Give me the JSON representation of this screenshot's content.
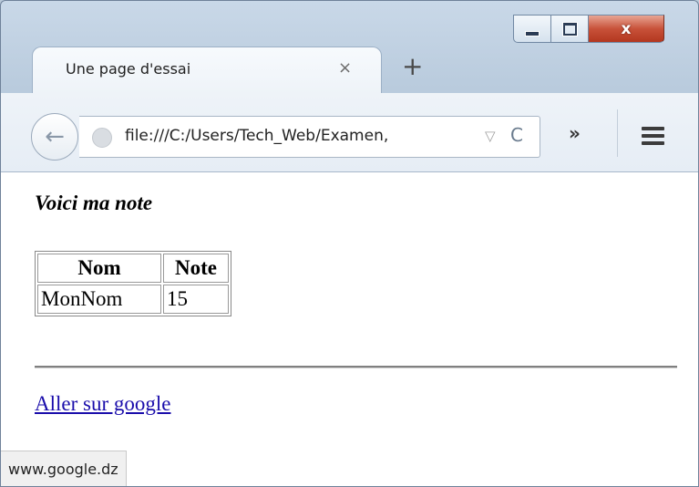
{
  "window": {
    "close_glyph": "x"
  },
  "tab": {
    "title": "Une page d'essai",
    "close_glyph": "×"
  },
  "new_tab_glyph": "+",
  "toolbar": {
    "back_glyph": "←",
    "url": "file:///C:/Users/Tech_Web/Examen,",
    "dropdown_glyph": "▽",
    "reload_glyph": "C",
    "overflow_glyph": "»"
  },
  "page": {
    "heading": "Voici ma note",
    "table": {
      "headers": [
        "Nom",
        "Note"
      ],
      "rows": [
        [
          "MonNom",
          "15"
        ]
      ]
    },
    "link_text": "Aller sur google"
  },
  "status_bar": {
    "text": "www.google.dz"
  },
  "icons": [
    "minimize-icon",
    "maximize-icon",
    "close-icon",
    "back-arrow-icon",
    "globe-icon",
    "reload-icon",
    "hamburger-menu-icon"
  ]
}
